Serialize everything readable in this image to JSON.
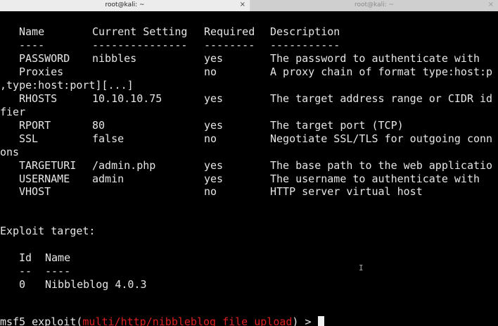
{
  "tabs": [
    {
      "title": "root@kali: ~",
      "close": "×"
    },
    {
      "title": "root@kali: ~",
      "close": "×"
    }
  ],
  "options": {
    "headers": [
      "Name",
      "Current Setting",
      "Required",
      "Description"
    ],
    "separators": [
      "----",
      "---------------",
      "--------",
      "-----------"
    ],
    "rows": [
      {
        "name": "PASSWORD",
        "setting": "nibbles",
        "required": "yes",
        "description": "The password to authenticate with"
      },
      {
        "name": "Proxies",
        "setting": "",
        "required": "no",
        "description": "A proxy chain of format type:host:p",
        "wrap": ",type:host:port][...]"
      },
      {
        "name": "RHOSTS",
        "setting": "10.10.10.75",
        "required": "yes",
        "description": "The target address range or CIDR id",
        "wrap": "fier"
      },
      {
        "name": "RPORT",
        "setting": "80",
        "required": "yes",
        "description": "The target port (TCP)"
      },
      {
        "name": "SSL",
        "setting": "false",
        "required": "no",
        "description": "Negotiate SSL/TLS for outgoing conn",
        "wrap": "ons"
      },
      {
        "name": "TARGETURI",
        "setting": "/admin.php",
        "required": "yes",
        "description": "The base path to the web applicatio"
      },
      {
        "name": "USERNAME",
        "setting": "admin",
        "required": "yes",
        "description": "The username to authenticate with"
      },
      {
        "name": "VHOST",
        "setting": "",
        "required": "no",
        "description": "HTTP server virtual host"
      }
    ]
  },
  "exploit_target": {
    "heading": "Exploit target:",
    "headers": [
      "Id",
      "Name"
    ],
    "separators": [
      "--",
      "----"
    ],
    "rows": [
      {
        "id": "0",
        "name": "Nibbleblog 4.0.3"
      }
    ]
  },
  "prompt": {
    "prefix": "msf5 exploit(",
    "module": "multi/http/nibbleblog_file_upload",
    "suffix": ") > "
  },
  "colors": {
    "background": "#000000",
    "text": "#e6e6e6",
    "module": "#e02020"
  }
}
